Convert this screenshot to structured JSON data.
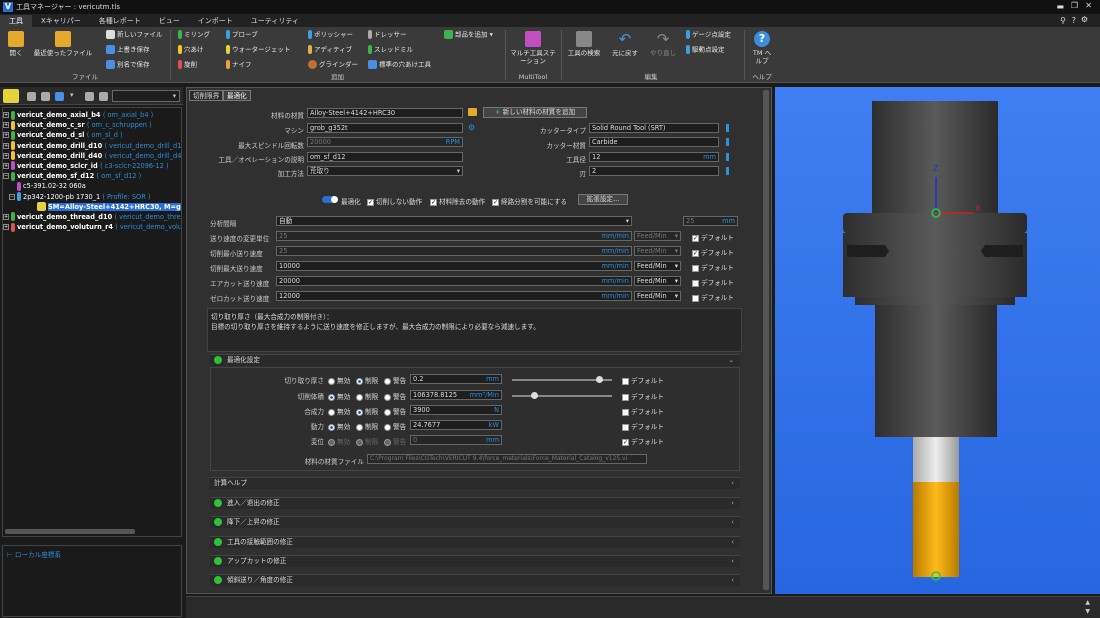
{
  "window": {
    "title": "工具マネージャー : vericutm.tls"
  },
  "menu": {
    "tabs": [
      "工具",
      "Xキャリパー",
      "各種レポート",
      "ビュー",
      "インポート",
      "ユーティリティ"
    ]
  },
  "ribbon": {
    "open": "開く",
    "recent": "最近使ったファイル",
    "new_file": "新しいファイル",
    "overwrite": "上書き保存",
    "save_as": "別名で保存",
    "file_group": "ファイル",
    "milling": "ミリング",
    "drill": "穴あけ",
    "turning": "旋削",
    "probe": "プローブ",
    "waterjet": "ウォータージェット",
    "knife": "ナイフ",
    "polisher": "ポリッシャー",
    "additive": "アディティブ",
    "grinder": "グラインダー",
    "dresser": "ドレッサー",
    "sled_mill": "スレッドミル",
    "std_hole": "標準の穴あけ工具",
    "add_part": "部品を追加",
    "add_group": "追加",
    "multi_tool": "マルチ工具ステーション",
    "multitool_group": "MultiTool",
    "search_tool": "工具の検索",
    "undo": "元に戻す",
    "redo": "やり直し",
    "gauge_point": "ゲージ点設定",
    "drive_point": "駆動点設定",
    "edit_group": "編集",
    "tm_help": "TM ヘルプ",
    "help_group": "ヘルプ"
  },
  "tree": {
    "items": [
      {
        "name": "vericut_demo_axial_b4",
        "sub": "( om_axial_b4 )"
      },
      {
        "name": "vericut_demo_c_sr",
        "sub": "( om_c_schruppen )"
      },
      {
        "name": "vericut_demo_d_sl",
        "sub": "( om_sl_d )"
      },
      {
        "name": "vericut_demo_drill_d10",
        "sub": "( vericut_demo_drill_d1"
      },
      {
        "name": "vericut_demo_drill_d40",
        "sub": "( vericut_demo_drill_d4"
      },
      {
        "name": "vericut_demo_sclcr_id",
        "sub": "( c3-sclcr-22096-12 )"
      },
      {
        "name": "vericut_demo_sf_d12",
        "sub": "( om_sf_d12 )"
      },
      {
        "name": "c5-391.02-32 060a",
        "sub": ""
      },
      {
        "name": "2p342-1200-pb 1730_1",
        "sub": "( Profile: SOR )"
      },
      {
        "name": "SM=Alloy-Steel+4142+HRC30, M=grob_g3",
        "sub": ""
      },
      {
        "name": "vericut_demo_thread_d10",
        "sub": "( vericut_demo_threa"
      },
      {
        "name": "vericut_demo_voluturn_r4",
        "sub": "( vericut_demo_volut"
      }
    ],
    "local_coords": "ローカル座標系"
  },
  "tabs": {
    "cut_limits": "切削限界",
    "optimize": "最適化"
  },
  "form": {
    "material_label": "材料の材質",
    "material_value": "Alloy-Steel+4142+HRC30",
    "add_material": "新しい材料の材質を追加",
    "machine_label": "マシン",
    "machine_value": "grob_g352t",
    "max_rpm_label": "最大スピンドル回転数",
    "max_rpm_value": "20000",
    "rpm_unit": "RPM",
    "desc_label": "工具／オペレーションの説明",
    "desc_value": "om_sf_d12",
    "method_label": "加工方法",
    "method_value": "荒取り",
    "cutter_type_label": "カッタータイプ",
    "cutter_type_value": "Solid Round Tool (SRT)",
    "cutter_mat_label": "カッター材質",
    "cutter_mat_value": "Carbide",
    "tool_dia_label": "工具径",
    "tool_dia_value": "12",
    "mm": "mm",
    "teeth_label": "刃",
    "teeth_value": "2"
  },
  "options": {
    "optimize": "最適化",
    "no_cut": "切削しない動作",
    "material_removal": "材料除去の動作",
    "split": "経路分割を可能にする",
    "advanced": "拡張設定..."
  },
  "feeds": {
    "division_label": "分析間隔",
    "division_value": "自動",
    "division_num": "25",
    "mm_min": "mm/min",
    "feed_unit": "Feed/Min",
    "default": "デフォルト",
    "rows": [
      {
        "label": "送り速度の変更単位",
        "value": "25",
        "unit": "Feed/Min",
        "def": true
      },
      {
        "label": "切削最小送り速度",
        "value": "25",
        "unit": "Feed/Min",
        "def": true
      },
      {
        "label": "切削最大送り速度",
        "value": "10000",
        "unit": "Feed/Min",
        "def": false
      },
      {
        "label": "エアカット送り速度",
        "value": "20000",
        "unit": "Feed/Min",
        "def": false
      },
      {
        "label": "ゼロカット送り速度",
        "value": "12000",
        "unit": "Feed/Min",
        "def": false
      }
    ]
  },
  "desc": {
    "title": "切り取り厚さ（最大合成力の制限付き）：",
    "body": "目標の切り取り厚さを維持するように送り速度を修正しますが、最大合成力の制限により必要なら減速します。"
  },
  "opt_settings": {
    "title": "最適化設定",
    "none": "無効",
    "limit": "制限",
    "warn": "警告",
    "rows": [
      {
        "label": "切り取り厚さ",
        "value": "0.2",
        "unit": "mm",
        "sel": "limit",
        "slider": 0.9
      },
      {
        "label": "切削体積",
        "value": "106378.8125",
        "unit": "mm³/Min",
        "sel": "none",
        "slider": 0.2
      },
      {
        "label": "合成力",
        "value": "3900",
        "unit": "N",
        "sel": "limit"
      },
      {
        "label": "動力",
        "value": "24.7677",
        "unit": "kW",
        "sel": "none"
      },
      {
        "label": "変位",
        "value": "0",
        "unit": "mm",
        "sel": "disabled",
        "def": true
      }
    ],
    "matfile_label": "材料の材質ファイル",
    "matfile_value": "C:\\Program Files\\CGTech\\VERICUT 9.4\\force_materials\\Force_Material_Catalog_v125.vi"
  },
  "sections": [
    {
      "title": "計算ヘルプ",
      "dot": false
    },
    {
      "title": "進入／退出の修正",
      "dot": true
    },
    {
      "title": "降下／上昇の修正",
      "dot": true
    },
    {
      "title": "工具の接触範囲の修正",
      "dot": true
    },
    {
      "title": "アップカットの修正",
      "dot": true
    },
    {
      "title": "傾斜送り／角度の修正",
      "dot": true
    }
  ],
  "colors": {
    "accent": "#2a6fd6",
    "viewport": "#3f7ff2",
    "tool_body": "#474747",
    "cutter": "#f0a80a"
  }
}
